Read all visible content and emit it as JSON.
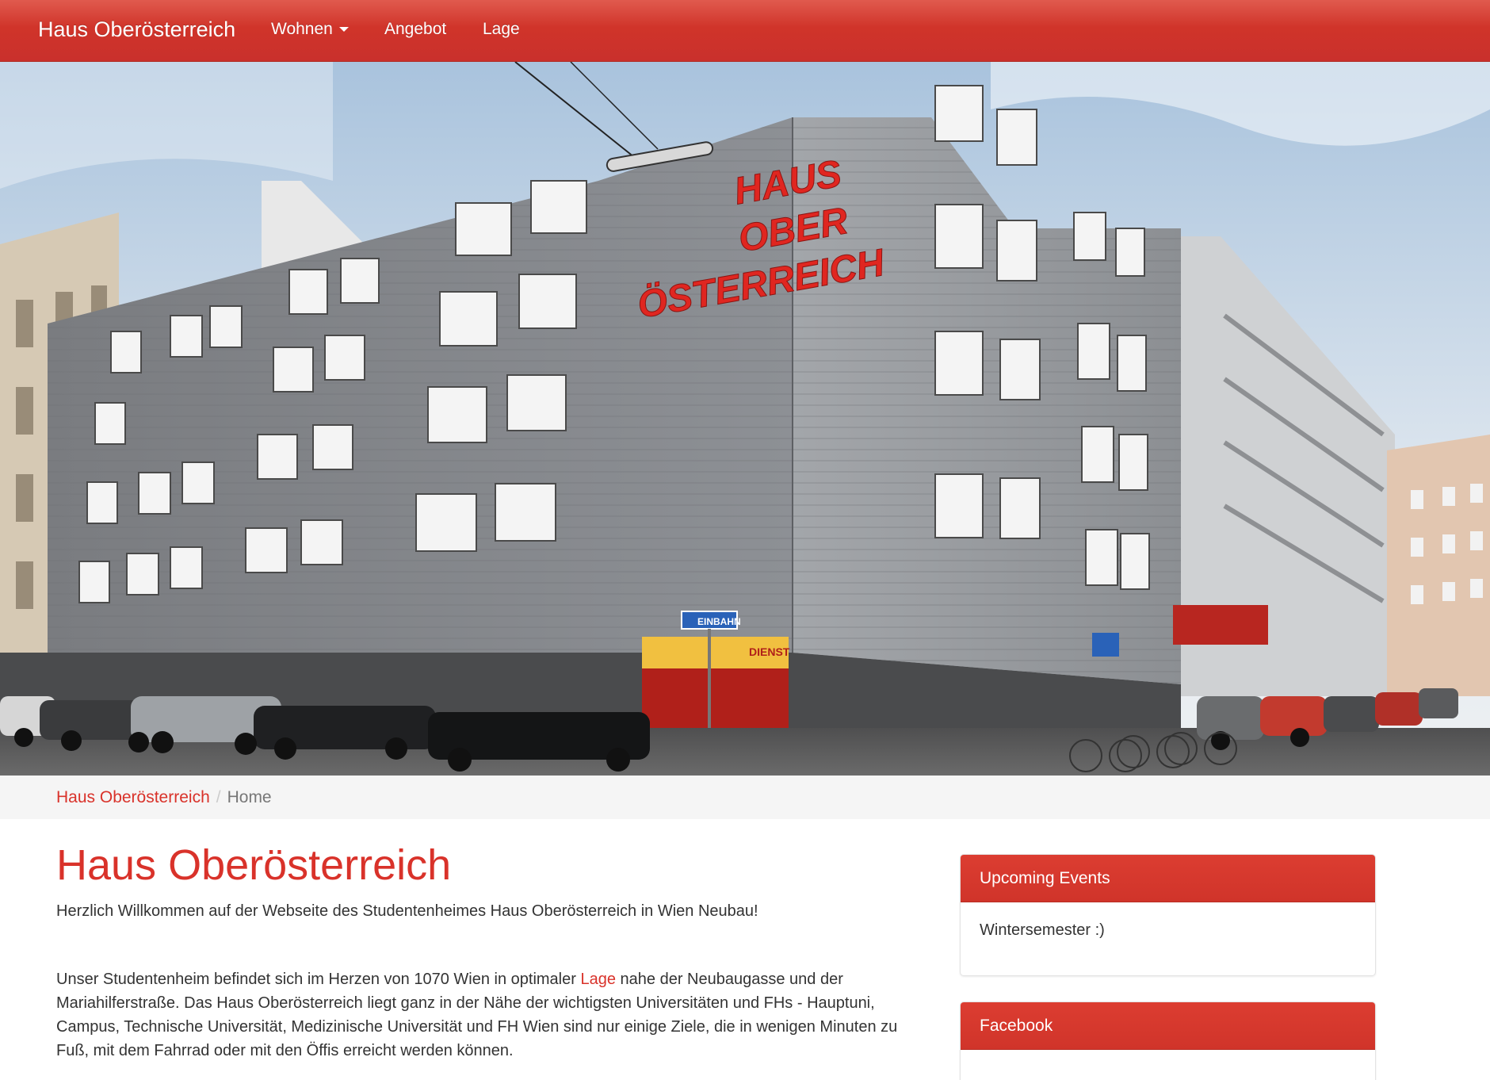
{
  "navbar": {
    "brand": "Haus Oberösterreich",
    "items": [
      {
        "label": "Wohnen",
        "has_dropdown": true,
        "icon": "caret-down-icon"
      },
      {
        "label": "Angebot"
      },
      {
        "label": "Lage"
      }
    ],
    "accent_color": "#d0342a"
  },
  "hero": {
    "sign_lines": [
      "HAUS",
      "OBER",
      "ÖSTERREICH"
    ],
    "street_sign": "EINBAHN",
    "shop_sign": "DIENST"
  },
  "breadcrumb": {
    "items": [
      "Haus Oberösterreich",
      "Home"
    ],
    "separator": "/"
  },
  "main": {
    "title": "Haus Oberösterreich",
    "intro": "Herzlich Willkommen auf der Webseite des Studentenheimes Haus Oberösterreich in Wien Neubau!",
    "para_before_link": "Unser Studentenheim befindet sich im Herzen von 1070 Wien in optimaler ",
    "para_link": "Lage",
    "para_after_link": " nahe der Neubaugasse und der Mariahilferstraße. Das Haus Oberösterreich liegt ganz in der Nähe der wichtigsten Universitäten und FHs - Hauptuni, Campus, Technische Universität, Medizinische Universität und FH Wien sind nur einige Ziele, die in wenigen Minuten zu Fuß, mit dem Fahrrad oder mit den Öffis erreicht werden können."
  },
  "sidebar": {
    "events": {
      "heading": "Upcoming Events",
      "body": "Wintersemester :)"
    },
    "facebook": {
      "heading": "Facebook"
    }
  }
}
